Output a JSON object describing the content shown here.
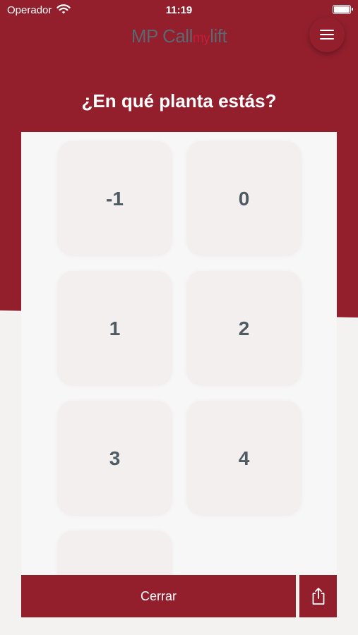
{
  "status": {
    "carrier": "Operador",
    "time": "11:19"
  },
  "header": {
    "logo_part1": "MP Call",
    "logo_part2": "my",
    "logo_part3": "lift"
  },
  "title": "¿En qué planta estás?",
  "floors": [
    "-1",
    "0",
    "1",
    "2",
    "3",
    "4",
    ""
  ],
  "footer": {
    "close_label": "Cerrar"
  },
  "colors": {
    "brand_red": "#931f2d",
    "logo_grey": "#5c6770",
    "logo_red": "#c21e3a",
    "floor_text": "#4f5b63"
  },
  "icons": {
    "menu": "hamburger-icon",
    "share": "share-icon",
    "wifi": "wifi-icon",
    "battery": "battery-icon"
  }
}
